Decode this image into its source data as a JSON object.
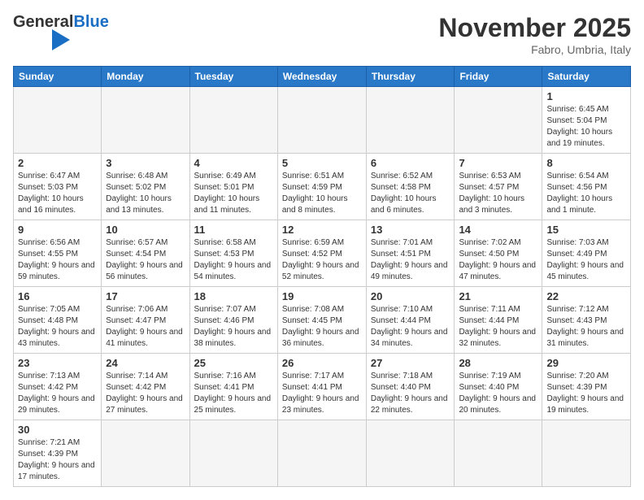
{
  "header": {
    "logo_general": "General",
    "logo_blue": "Blue",
    "month_title": "November 2025",
    "subtitle": "Fabro, Umbria, Italy"
  },
  "weekdays": [
    "Sunday",
    "Monday",
    "Tuesday",
    "Wednesday",
    "Thursday",
    "Friday",
    "Saturday"
  ],
  "weeks": [
    [
      {
        "day": "",
        "info": ""
      },
      {
        "day": "",
        "info": ""
      },
      {
        "day": "",
        "info": ""
      },
      {
        "day": "",
        "info": ""
      },
      {
        "day": "",
        "info": ""
      },
      {
        "day": "",
        "info": ""
      },
      {
        "day": "1",
        "info": "Sunrise: 6:45 AM\nSunset: 5:04 PM\nDaylight: 10 hours\nand 19 minutes."
      }
    ],
    [
      {
        "day": "2",
        "info": "Sunrise: 6:47 AM\nSunset: 5:03 PM\nDaylight: 10 hours\nand 16 minutes."
      },
      {
        "day": "3",
        "info": "Sunrise: 6:48 AM\nSunset: 5:02 PM\nDaylight: 10 hours\nand 13 minutes."
      },
      {
        "day": "4",
        "info": "Sunrise: 6:49 AM\nSunset: 5:01 PM\nDaylight: 10 hours\nand 11 minutes."
      },
      {
        "day": "5",
        "info": "Sunrise: 6:51 AM\nSunset: 4:59 PM\nDaylight: 10 hours\nand 8 minutes."
      },
      {
        "day": "6",
        "info": "Sunrise: 6:52 AM\nSunset: 4:58 PM\nDaylight: 10 hours\nand 6 minutes."
      },
      {
        "day": "7",
        "info": "Sunrise: 6:53 AM\nSunset: 4:57 PM\nDaylight: 10 hours\nand 3 minutes."
      },
      {
        "day": "8",
        "info": "Sunrise: 6:54 AM\nSunset: 4:56 PM\nDaylight: 10 hours\nand 1 minute."
      }
    ],
    [
      {
        "day": "9",
        "info": "Sunrise: 6:56 AM\nSunset: 4:55 PM\nDaylight: 9 hours\nand 59 minutes."
      },
      {
        "day": "10",
        "info": "Sunrise: 6:57 AM\nSunset: 4:54 PM\nDaylight: 9 hours\nand 56 minutes."
      },
      {
        "day": "11",
        "info": "Sunrise: 6:58 AM\nSunset: 4:53 PM\nDaylight: 9 hours\nand 54 minutes."
      },
      {
        "day": "12",
        "info": "Sunrise: 6:59 AM\nSunset: 4:52 PM\nDaylight: 9 hours\nand 52 minutes."
      },
      {
        "day": "13",
        "info": "Sunrise: 7:01 AM\nSunset: 4:51 PM\nDaylight: 9 hours\nand 49 minutes."
      },
      {
        "day": "14",
        "info": "Sunrise: 7:02 AM\nSunset: 4:50 PM\nDaylight: 9 hours\nand 47 minutes."
      },
      {
        "day": "15",
        "info": "Sunrise: 7:03 AM\nSunset: 4:49 PM\nDaylight: 9 hours\nand 45 minutes."
      }
    ],
    [
      {
        "day": "16",
        "info": "Sunrise: 7:05 AM\nSunset: 4:48 PM\nDaylight: 9 hours\nand 43 minutes."
      },
      {
        "day": "17",
        "info": "Sunrise: 7:06 AM\nSunset: 4:47 PM\nDaylight: 9 hours\nand 41 minutes."
      },
      {
        "day": "18",
        "info": "Sunrise: 7:07 AM\nSunset: 4:46 PM\nDaylight: 9 hours\nand 38 minutes."
      },
      {
        "day": "19",
        "info": "Sunrise: 7:08 AM\nSunset: 4:45 PM\nDaylight: 9 hours\nand 36 minutes."
      },
      {
        "day": "20",
        "info": "Sunrise: 7:10 AM\nSunset: 4:44 PM\nDaylight: 9 hours\nand 34 minutes."
      },
      {
        "day": "21",
        "info": "Sunrise: 7:11 AM\nSunset: 4:44 PM\nDaylight: 9 hours\nand 32 minutes."
      },
      {
        "day": "22",
        "info": "Sunrise: 7:12 AM\nSunset: 4:43 PM\nDaylight: 9 hours\nand 31 minutes."
      }
    ],
    [
      {
        "day": "23",
        "info": "Sunrise: 7:13 AM\nSunset: 4:42 PM\nDaylight: 9 hours\nand 29 minutes."
      },
      {
        "day": "24",
        "info": "Sunrise: 7:14 AM\nSunset: 4:42 PM\nDaylight: 9 hours\nand 27 minutes."
      },
      {
        "day": "25",
        "info": "Sunrise: 7:16 AM\nSunset: 4:41 PM\nDaylight: 9 hours\nand 25 minutes."
      },
      {
        "day": "26",
        "info": "Sunrise: 7:17 AM\nSunset: 4:41 PM\nDaylight: 9 hours\nand 23 minutes."
      },
      {
        "day": "27",
        "info": "Sunrise: 7:18 AM\nSunset: 4:40 PM\nDaylight: 9 hours\nand 22 minutes."
      },
      {
        "day": "28",
        "info": "Sunrise: 7:19 AM\nSunset: 4:40 PM\nDaylight: 9 hours\nand 20 minutes."
      },
      {
        "day": "29",
        "info": "Sunrise: 7:20 AM\nSunset: 4:39 PM\nDaylight: 9 hours\nand 19 minutes."
      }
    ],
    [
      {
        "day": "30",
        "info": "Sunrise: 7:21 AM\nSunset: 4:39 PM\nDaylight: 9 hours\nand 17 minutes."
      },
      {
        "day": "",
        "info": ""
      },
      {
        "day": "",
        "info": ""
      },
      {
        "day": "",
        "info": ""
      },
      {
        "day": "",
        "info": ""
      },
      {
        "day": "",
        "info": ""
      },
      {
        "day": "",
        "info": ""
      }
    ]
  ]
}
